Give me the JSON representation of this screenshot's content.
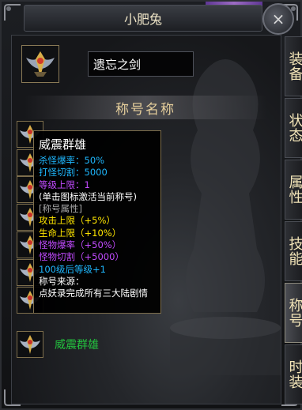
{
  "window": {
    "title": "小肥兔",
    "close_glyph": "×"
  },
  "profile": {
    "emblem_icon": "winged-crest-icon",
    "title_name": "遗忘之剑"
  },
  "section": {
    "header": "称号名称"
  },
  "titles": [
    {
      "label": "",
      "color": "#23c23e"
    },
    {
      "label": "",
      "color": "#23c23e"
    },
    {
      "label": "",
      "color": "#23c23e"
    },
    {
      "label": "",
      "color": "#23c23e"
    },
    {
      "label": "",
      "color": "#23c23e"
    },
    {
      "label": "",
      "color": "#23c23e"
    },
    {
      "label": "",
      "color": "#23c23e"
    },
    {
      "label": "威震群雄",
      "color": "#23c23e"
    }
  ],
  "tooltip": {
    "title": "威震群雄",
    "lines": [
      {
        "text": "杀怪爆率：50%",
        "color": "#1fb8ff"
      },
      {
        "text": "打怪切割：5000",
        "color": "#1fb8ff"
      },
      {
        "text": "等级上限：1",
        "color": "#c24bff"
      },
      {
        "text": "(单击图标激活当前称号)",
        "color": "#ffffff"
      },
      {
        "text": "[称号属性]",
        "color": "#a8a8a8"
      },
      {
        "text": "攻击上限（+5%）",
        "color": "#ffe600"
      },
      {
        "text": "生命上限（+10%）",
        "color": "#ffe600"
      },
      {
        "text": "怪物爆率（+50%）",
        "color": "#c24bff"
      },
      {
        "text": "怪物切割（+5000）",
        "color": "#c24bff"
      },
      {
        "text": "100级后等级+1",
        "color": "#1fb8ff"
      },
      {
        "text": "称号来源：",
        "color": "#ffffff"
      },
      {
        "text": "点妖录完成所有三大陆剧情",
        "color": "#ffffff"
      }
    ]
  },
  "side_tabs": [
    {
      "label": "装备",
      "active": false
    },
    {
      "label": "状态",
      "active": false
    },
    {
      "label": "属性",
      "active": false
    },
    {
      "label": "技能",
      "active": false
    },
    {
      "label": "称号",
      "active": true
    },
    {
      "label": "时装",
      "active": false
    }
  ],
  "colors": {
    "gold_text": "#e6cf9c",
    "green_text": "#23c23e",
    "tab_text": "#f3e5b8"
  }
}
